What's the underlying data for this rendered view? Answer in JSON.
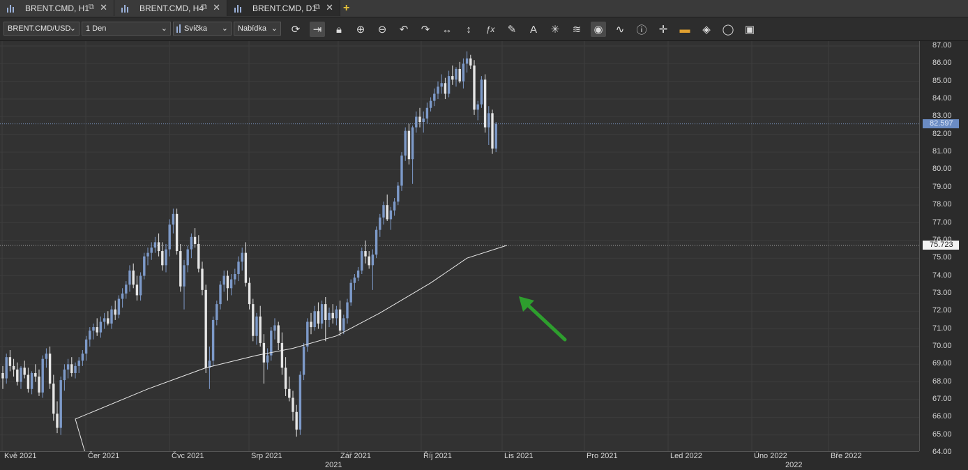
{
  "tabs": [
    {
      "label": "BRENT.CMD, H1",
      "active": false
    },
    {
      "label": "BRENT.CMD, H4",
      "active": false
    },
    {
      "label": "BRENT.CMD, D1",
      "active": true
    }
  ],
  "toolbar": {
    "instrument": "BRENT.CMD/USD",
    "period": "1 Den",
    "chart_type": "Svíčka",
    "side": "Nabídka"
  },
  "icons": [
    "refresh-icon",
    "shift-right-icon",
    "lock-icon",
    "zoom-in-icon",
    "zoom-out-icon",
    "undo-icon",
    "redo-icon",
    "horizontal-arrows-icon",
    "vertical-arrows-icon",
    "function-icon",
    "pencil-icon",
    "text-icon",
    "star-icon",
    "layers-icon",
    "eye-icon",
    "indicator-icon",
    "info-icon",
    "crosshair-icon",
    "color-bar-icon",
    "paint-bucket-icon",
    "circle-icon",
    "save-icon"
  ],
  "price_axis": {
    "labels": [
      "87.00",
      "86.00",
      "85.00",
      "84.00",
      "83.00",
      "82.00",
      "81.00",
      "80.00",
      "79.00",
      "78.00",
      "77.00",
      "76.00",
      "75.00",
      "74.00",
      "73.00",
      "72.00",
      "71.00",
      "70.00",
      "69.00",
      "68.00",
      "67.00",
      "66.00",
      "65.00",
      "64.00"
    ],
    "current_price": "82.597",
    "ma_price": "75.723"
  },
  "time_axis": {
    "labels": [
      "Kvě 2021",
      "Čer 2021",
      "Čvc 2021",
      "Srp 2021",
      "Zář 2021",
      "Říj 2021",
      "Lis 2021",
      "Pro 2021",
      "Led 2022",
      "Úno 2022",
      "Bře 2022"
    ],
    "years": [
      "2021",
      "2022"
    ]
  },
  "colors": {
    "up": "#7d9ac9",
    "down": "#e6e6e6",
    "ma": "#e8e8e8",
    "arrow": "#2e9e2e"
  },
  "chart_data": {
    "type": "candlestick",
    "ylim": [
      64,
      87.2
    ],
    "candles": [
      [
        68.5,
        68.9,
        67.6,
        68.2
      ],
      [
        68.2,
        69.6,
        67.9,
        69.4
      ],
      [
        69.4,
        69.8,
        68.6,
        68.9
      ],
      [
        68.9,
        69.3,
        68.3,
        68.7
      ],
      [
        68.7,
        69.1,
        67.8,
        68.0
      ],
      [
        68.0,
        68.9,
        67.6,
        68.8
      ],
      [
        68.8,
        69.2,
        68.2,
        68.4
      ],
      [
        68.4,
        68.8,
        67.4,
        67.6
      ],
      [
        67.6,
        68.6,
        67.3,
        68.5
      ],
      [
        68.5,
        69.0,
        68.0,
        68.3
      ],
      [
        68.3,
        68.7,
        67.2,
        67.4
      ],
      [
        67.4,
        69.5,
        67.1,
        69.3
      ],
      [
        69.3,
        69.9,
        68.8,
        69.6
      ],
      [
        69.6,
        70.0,
        67.6,
        67.9
      ],
      [
        67.9,
        68.4,
        65.8,
        66.2
      ],
      [
        66.2,
        66.9,
        65.1,
        65.4
      ],
      [
        65.4,
        68.3,
        65.0,
        68.1
      ],
      [
        68.1,
        69.0,
        67.5,
        68.7
      ],
      [
        68.7,
        69.3,
        68.2,
        69.0
      ],
      [
        69.0,
        69.4,
        68.3,
        68.5
      ],
      [
        68.5,
        69.1,
        68.2,
        68.9
      ],
      [
        68.9,
        69.4,
        68.5,
        69.2
      ],
      [
        69.2,
        69.8,
        68.9,
        69.6
      ],
      [
        69.6,
        70.6,
        69.2,
        70.4
      ],
      [
        70.4,
        71.1,
        70.0,
        70.9
      ],
      [
        70.9,
        71.3,
        70.4,
        71.1
      ],
      [
        71.1,
        71.6,
        70.6,
        70.8
      ],
      [
        70.8,
        71.7,
        70.5,
        71.4
      ],
      [
        71.4,
        71.9,
        71.0,
        71.6
      ],
      [
        71.6,
        72.0,
        71.2,
        71.3
      ],
      [
        71.3,
        72.3,
        71.0,
        72.1
      ],
      [
        72.1,
        72.6,
        71.5,
        71.8
      ],
      [
        71.8,
        72.9,
        71.6,
        72.7
      ],
      [
        72.7,
        73.3,
        72.2,
        73.0
      ],
      [
        73.0,
        73.7,
        72.7,
        73.5
      ],
      [
        73.5,
        74.6,
        73.1,
        74.3
      ],
      [
        74.3,
        74.7,
        73.3,
        73.5
      ],
      [
        73.5,
        74.0,
        72.6,
        72.9
      ],
      [
        72.9,
        74.2,
        72.6,
        74.0
      ],
      [
        74.0,
        75.3,
        73.8,
        75.1
      ],
      [
        75.1,
        75.6,
        74.6,
        75.3
      ],
      [
        75.3,
        75.9,
        74.9,
        75.6
      ],
      [
        75.6,
        76.2,
        75.3,
        75.9
      ],
      [
        75.9,
        76.4,
        75.1,
        75.4
      ],
      [
        75.4,
        75.9,
        74.3,
        74.6
      ],
      [
        74.6,
        75.8,
        74.2,
        75.5
      ],
      [
        75.5,
        77.2,
        75.1,
        76.9
      ],
      [
        76.9,
        77.8,
        76.4,
        77.5
      ],
      [
        77.5,
        77.8,
        75.2,
        75.4
      ],
      [
        75.4,
        75.8,
        73.1,
        73.4
      ],
      [
        73.4,
        74.9,
        72.1,
        74.6
      ],
      [
        74.6,
        75.7,
        74.2,
        75.5
      ],
      [
        75.5,
        76.4,
        75.0,
        76.2
      ],
      [
        76.2,
        76.7,
        75.6,
        75.8
      ],
      [
        75.8,
        76.3,
        74.2,
        74.4
      ],
      [
        74.4,
        74.8,
        72.9,
        73.2
      ],
      [
        73.2,
        73.5,
        68.5,
        68.8
      ],
      [
        68.8,
        70.0,
        67.6,
        69.2
      ],
      [
        69.2,
        71.7,
        68.9,
        71.5
      ],
      [
        71.5,
        72.6,
        71.2,
        72.4
      ],
      [
        72.4,
        73.7,
        72.1,
        73.5
      ],
      [
        73.5,
        74.3,
        73.1,
        74.0
      ],
      [
        74.0,
        74.3,
        72.6,
        73.3
      ],
      [
        73.3,
        74.1,
        72.9,
        73.8
      ],
      [
        73.8,
        74.4,
        73.5,
        74.1
      ],
      [
        74.1,
        75.1,
        73.7,
        74.8
      ],
      [
        74.8,
        75.6,
        74.3,
        75.3
      ],
      [
        75.3,
        75.9,
        73.4,
        73.6
      ],
      [
        73.6,
        73.9,
        72.1,
        72.4
      ],
      [
        72.4,
        72.7,
        70.3,
        70.6
      ],
      [
        70.6,
        71.9,
        70.1,
        71.7
      ],
      [
        71.7,
        72.3,
        70.0,
        70.2
      ],
      [
        70.2,
        70.7,
        67.9,
        69.1
      ],
      [
        69.1,
        69.9,
        68.7,
        69.5
      ],
      [
        69.5,
        71.1,
        69.2,
        70.9
      ],
      [
        70.9,
        71.6,
        70.4,
        71.2
      ],
      [
        71.2,
        71.4,
        69.8,
        70.2
      ],
      [
        70.2,
        70.8,
        68.4,
        68.8
      ],
      [
        68.8,
        69.4,
        67.2,
        67.6
      ],
      [
        67.6,
        68.3,
        66.9,
        67.1
      ],
      [
        67.1,
        67.5,
        65.8,
        66.3
      ],
      [
        66.3,
        66.7,
        64.9,
        65.3
      ],
      [
        65.3,
        68.6,
        65.0,
        68.4
      ],
      [
        68.4,
        70.2,
        68.1,
        70.0
      ],
      [
        70.0,
        71.6,
        69.7,
        71.4
      ],
      [
        71.4,
        71.9,
        70.7,
        71.1
      ],
      [
        71.1,
        72.3,
        70.9,
        72.0
      ],
      [
        72.0,
        72.5,
        71.0,
        71.3
      ],
      [
        71.3,
        72.6,
        71.0,
        72.4
      ],
      [
        72.4,
        72.8,
        70.3,
        71.5
      ],
      [
        71.5,
        72.2,
        71.1,
        71.9
      ],
      [
        71.9,
        72.4,
        71.3,
        71.6
      ],
      [
        71.6,
        72.3,
        71.2,
        72.1
      ],
      [
        72.1,
        72.6,
        70.6,
        70.9
      ],
      [
        70.9,
        71.8,
        70.7,
        71.6
      ],
      [
        71.6,
        72.7,
        71.3,
        72.5
      ],
      [
        72.5,
        73.8,
        72.3,
        73.6
      ],
      [
        73.6,
        74.1,
        73.2,
        73.9
      ],
      [
        73.9,
        74.5,
        73.7,
        74.3
      ],
      [
        74.3,
        75.6,
        74.1,
        75.4
      ],
      [
        75.4,
        76.0,
        74.7,
        75.1
      ],
      [
        75.1,
        75.4,
        74.4,
        74.6
      ],
      [
        74.6,
        75.5,
        73.2,
        75.2
      ],
      [
        75.2,
        76.8,
        75.0,
        76.6
      ],
      [
        76.6,
        77.5,
        76.2,
        77.3
      ],
      [
        77.3,
        78.2,
        76.9,
        78.0
      ],
      [
        78.0,
        78.6,
        77.1,
        77.2
      ],
      [
        77.2,
        77.9,
        76.6,
        77.7
      ],
      [
        77.7,
        78.4,
        77.4,
        78.2
      ],
      [
        78.2,
        79.3,
        78.0,
        79.1
      ],
      [
        79.1,
        81.0,
        78.8,
        80.8
      ],
      [
        80.8,
        82.4,
        80.5,
        82.2
      ],
      [
        82.2,
        82.6,
        80.3,
        80.6
      ],
      [
        80.6,
        82.5,
        79.2,
        82.4
      ],
      [
        82.4,
        83.3,
        82.1,
        83.0
      ],
      [
        83.0,
        83.5,
        82.4,
        82.7
      ],
      [
        82.7,
        83.3,
        82.1,
        82.9
      ],
      [
        82.9,
        83.8,
        82.6,
        83.5
      ],
      [
        83.5,
        84.1,
        83.3,
        83.9
      ],
      [
        83.9,
        84.6,
        83.6,
        84.3
      ],
      [
        84.3,
        85.0,
        84.0,
        84.7
      ],
      [
        84.7,
        85.4,
        84.3,
        84.9
      ],
      [
        84.9,
        85.2,
        84.0,
        84.3
      ],
      [
        84.3,
        85.6,
        84.1,
        85.3
      ],
      [
        85.3,
        85.9,
        84.8,
        85.1
      ],
      [
        85.1,
        85.8,
        84.7,
        85.7
      ],
      [
        85.7,
        86.1,
        84.9,
        85.0
      ],
      [
        85.0,
        86.3,
        84.6,
        86.0
      ],
      [
        86.0,
        86.7,
        85.5,
        86.3
      ],
      [
        86.3,
        86.5,
        85.7,
        85.9
      ],
      [
        85.9,
        86.2,
        83.1,
        83.4
      ],
      [
        83.4,
        83.9,
        82.8,
        83.7
      ],
      [
        83.7,
        85.3,
        83.5,
        85.1
      ],
      [
        85.1,
        85.4,
        82.1,
        82.4
      ],
      [
        82.4,
        83.6,
        81.4,
        83.2
      ],
      [
        83.2,
        83.4,
        80.9,
        81.2
      ],
      [
        81.2,
        82.7,
        81.0,
        82.6
      ]
    ],
    "moving_average": [
      [
        0,
        64.0
      ],
      [
        20,
        65.9
      ],
      [
        40,
        67.6
      ],
      [
        56,
        68.8
      ],
      [
        70,
        69.5
      ],
      [
        80,
        69.9
      ],
      [
        92,
        70.6
      ],
      [
        104,
        71.9
      ],
      [
        118,
        73.6
      ],
      [
        128,
        75.0
      ],
      [
        139,
        75.72
      ]
    ]
  }
}
